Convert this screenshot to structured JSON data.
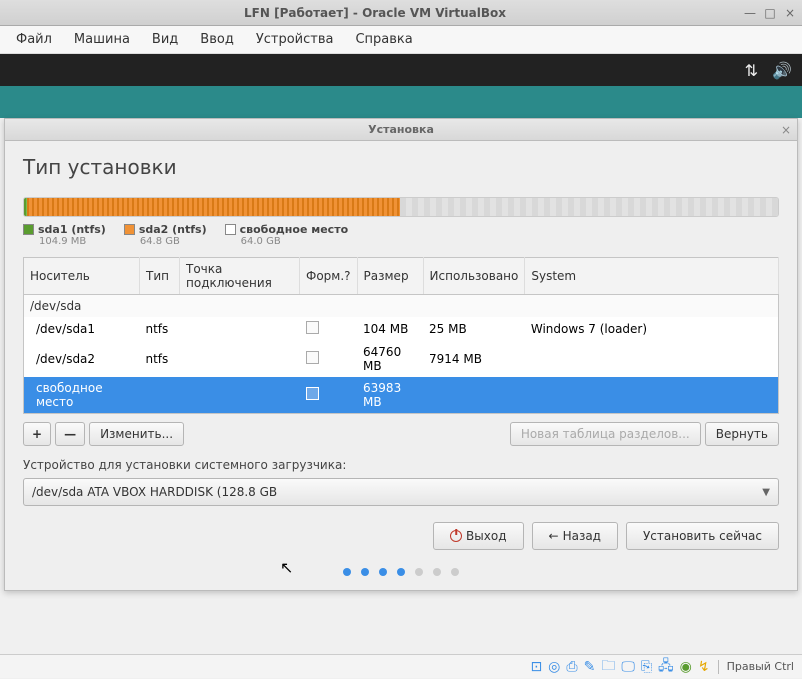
{
  "outer_window": {
    "title": "LFN [Работает] - Oracle VM VirtualBox",
    "minimize": "—",
    "maximize": "□",
    "close": "×"
  },
  "menubar": {
    "items": [
      "Файл",
      "Машина",
      "Вид",
      "Ввод",
      "Устройства",
      "Справка"
    ]
  },
  "installer": {
    "titlebar": "Установка",
    "close": "×",
    "heading": "Тип установки",
    "legend": [
      {
        "name": "sda1 (ntfs)",
        "size": "104.9 MB",
        "swatch": "green"
      },
      {
        "name": "sda2 (ntfs)",
        "size": "64.8 GB",
        "swatch": "orange"
      },
      {
        "name": "свободное место",
        "size": "64.0 GB",
        "swatch": "white"
      }
    ],
    "columns": {
      "device": "Носитель",
      "type": "Тип",
      "mount": "Точка подключения",
      "format": "Форм.?",
      "size": "Размер",
      "used": "Использовано",
      "system": "System"
    },
    "parent_row": {
      "device": "/dev/sda"
    },
    "rows": [
      {
        "device": "/dev/sda1",
        "type": "ntfs",
        "mount": "",
        "format": "checkbox",
        "size": "104 MB",
        "used": "25 MB",
        "system": "Windows 7 (loader)",
        "selected": false
      },
      {
        "device": "/dev/sda2",
        "type": "ntfs",
        "mount": "",
        "format": "checkbox",
        "size": "64760 MB",
        "used": "7914 MB",
        "system": "",
        "selected": false
      },
      {
        "device": "свободное место",
        "type": "",
        "mount": "",
        "format": "checkbox",
        "size": "63983 MB",
        "used": "",
        "system": "",
        "selected": true
      }
    ],
    "buttons": {
      "add": "+",
      "remove": "—",
      "change": "Изменить...",
      "new_table": "Новая таблица разделов...",
      "revert": "Вернуть"
    },
    "bootloader_label": "Устройство для установки системного загрузчика:",
    "bootloader_value": "/dev/sda   ATA VBOX HARDDISK (128.8 GB",
    "nav": {
      "quit": "Выход",
      "back": "Назад",
      "install": "Установить сейчас"
    },
    "pager_active": [
      true,
      true,
      true,
      true,
      false,
      false,
      false
    ]
  },
  "statusbar": {
    "host_key": "Правый Ctrl"
  }
}
